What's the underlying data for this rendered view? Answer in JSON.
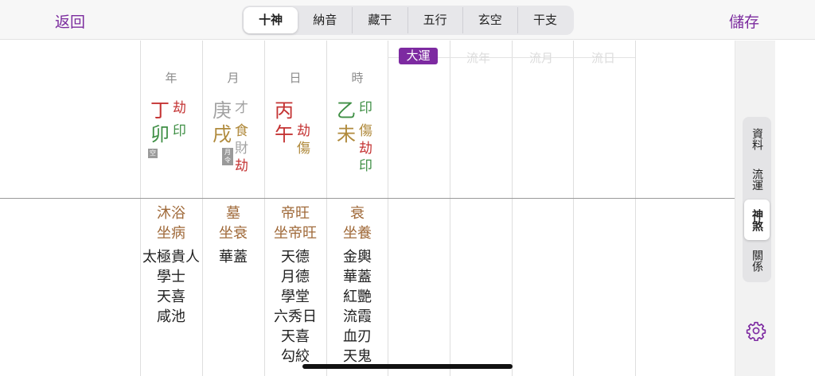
{
  "nav": {
    "back": "返回",
    "save": "儲存"
  },
  "segments": [
    {
      "label": "十神",
      "active": true
    },
    {
      "label": "納音",
      "active": false
    },
    {
      "label": "藏干",
      "active": false
    },
    {
      "label": "五行",
      "active": false
    },
    {
      "label": "玄空",
      "active": false
    },
    {
      "label": "干支",
      "active": false
    }
  ],
  "pillars": {
    "year": {
      "header": "年",
      "stem": "丁",
      "branch": "卯",
      "stem_god": "劫",
      "branch_gods": [
        "印"
      ],
      "badge": "空"
    },
    "month": {
      "header": "月",
      "stem": "庚",
      "branch": "戌",
      "stem_god": "才",
      "branch_gods": [
        "食",
        "財",
        "劫"
      ],
      "badge": "月令"
    },
    "day": {
      "header": "日",
      "stem": "丙",
      "branch": "午",
      "stem_god": "",
      "branch_gods": [
        "劫",
        "傷"
      ]
    },
    "hour": {
      "header": "時",
      "stem": "乙",
      "branch": "未",
      "stem_god": "印",
      "branch_gods": [
        "傷",
        "劫",
        "印"
      ]
    }
  },
  "stages": {
    "year": [
      "沐浴",
      "坐病"
    ],
    "month": [
      "墓",
      "坐衰"
    ],
    "day": [
      "帝旺",
      "坐帝旺"
    ],
    "hour": [
      "衰",
      "坐養"
    ]
  },
  "stars": {
    "year": [
      "太極貴人",
      "學士",
      "天喜",
      "咸池"
    ],
    "month": [
      "華蓋"
    ],
    "day": [
      "天德",
      "月德",
      "學堂",
      "六秀日",
      "天喜",
      "勾絞"
    ],
    "hour": [
      "金輿",
      "華蓋",
      "紅艷",
      "流霞",
      "血刃",
      "天鬼"
    ]
  },
  "luck": {
    "dayun": "大運",
    "liunian": "流年",
    "liuyue": "流月",
    "liuri": "流日"
  },
  "side_tabs": [
    {
      "label": "資料",
      "active": false
    },
    {
      "label": "流運",
      "active": false
    },
    {
      "label": "神煞",
      "active": true
    },
    {
      "label": "關係",
      "active": false
    }
  ],
  "colors": {
    "accent": "#7d2aa1",
    "fire": "#c43333",
    "wood": "#3f8f45",
    "metal": "#a3a3a3",
    "earth": "#b08a3c"
  },
  "icons": {
    "settings": "gear-icon"
  }
}
